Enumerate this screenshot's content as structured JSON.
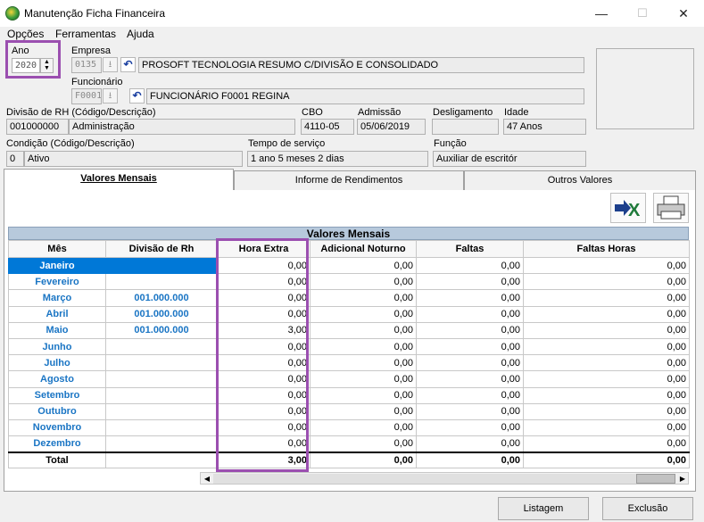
{
  "window": {
    "title": "Manutenção Ficha Financeira",
    "min": "—",
    "max": "☐",
    "close": "✕"
  },
  "menu": [
    "Opções",
    "Ferramentas",
    "Ajuda"
  ],
  "ano": {
    "label": "Ano",
    "value": "2020"
  },
  "empresa": {
    "label": "Empresa",
    "code": "0135",
    "name": "PROSOFT TECNOLOGIA RESUMO C/DIVISÃO E CONSOLIDADO"
  },
  "funcionario": {
    "label": "Funcionário",
    "code": "F0001",
    "name": "FUNCIONÁRIO F0001 REGINA"
  },
  "divisao": {
    "label": "Divisão de RH (Código/Descrição)",
    "code": "001000000",
    "desc": "Administração"
  },
  "cbo": {
    "label": "CBO",
    "value": "4110-05"
  },
  "admissao": {
    "label": "Admissão",
    "value": "05/06/2019"
  },
  "desligamento": {
    "label": "Desligamento",
    "value": ""
  },
  "idade": {
    "label": "Idade",
    "value": "47 Anos"
  },
  "condicao": {
    "label": "Condição (Código/Descrição)",
    "code": "0",
    "desc": "Ativo"
  },
  "tempo": {
    "label": "Tempo de serviço",
    "value": "1 ano 5 meses 2 dias"
  },
  "funcao": {
    "label": "Função",
    "value": "Auxiliar de escritór"
  },
  "tabs": [
    "Valores Mensais",
    "Informe de Rendimentos",
    "Outros Valores"
  ],
  "grid": {
    "title": "Valores Mensais",
    "headers": [
      "Mês",
      "Divisão de Rh",
      "Hora Extra",
      "Adicional Noturno",
      "Faltas",
      "Faltas Horas"
    ],
    "rows": [
      {
        "mes": "Janeiro",
        "div": "",
        "he": "0,00",
        "an": "0,00",
        "f": "0,00",
        "fh": "0,00"
      },
      {
        "mes": "Fevereiro",
        "div": "",
        "he": "0,00",
        "an": "0,00",
        "f": "0,00",
        "fh": "0,00"
      },
      {
        "mes": "Março",
        "div": "001.000.000",
        "he": "0,00",
        "an": "0,00",
        "f": "0,00",
        "fh": "0,00"
      },
      {
        "mes": "Abril",
        "div": "001.000.000",
        "he": "0,00",
        "an": "0,00",
        "f": "0,00",
        "fh": "0,00"
      },
      {
        "mes": "Maio",
        "div": "001.000.000",
        "he": "3,00",
        "an": "0,00",
        "f": "0,00",
        "fh": "0,00"
      },
      {
        "mes": "Junho",
        "div": "",
        "he": "0,00",
        "an": "0,00",
        "f": "0,00",
        "fh": "0,00"
      },
      {
        "mes": "Julho",
        "div": "",
        "he": "0,00",
        "an": "0,00",
        "f": "0,00",
        "fh": "0,00"
      },
      {
        "mes": "Agosto",
        "div": "",
        "he": "0,00",
        "an": "0,00",
        "f": "0,00",
        "fh": "0,00"
      },
      {
        "mes": "Setembro",
        "div": "",
        "he": "0,00",
        "an": "0,00",
        "f": "0,00",
        "fh": "0,00"
      },
      {
        "mes": "Outubro",
        "div": "",
        "he": "0,00",
        "an": "0,00",
        "f": "0,00",
        "fh": "0,00"
      },
      {
        "mes": "Novembro",
        "div": "",
        "he": "0,00",
        "an": "0,00",
        "f": "0,00",
        "fh": "0,00"
      },
      {
        "mes": "Dezembro",
        "div": "",
        "he": "0,00",
        "an": "0,00",
        "f": "0,00",
        "fh": "0,00"
      }
    ],
    "total": {
      "label": "Total",
      "he": "3,00",
      "an": "0,00",
      "f": "0,00",
      "fh": "0,00"
    }
  },
  "buttons": {
    "listagem": "Listagem",
    "exclusao": "Exclusão"
  },
  "colors": {
    "highlight": "#9b4fb0",
    "selection": "#0078d7",
    "month_text": "#1a75c4",
    "grid_header": "#b7c9dc"
  }
}
